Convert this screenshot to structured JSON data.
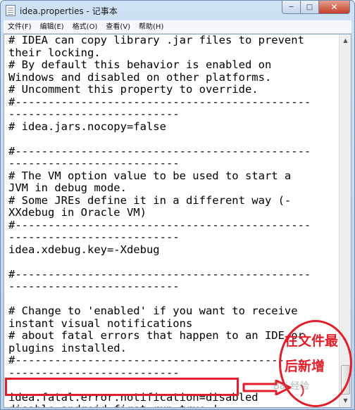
{
  "window": {
    "title": "idea.properties - 记事本",
    "minimize_glyph": "─",
    "maximize_glyph": "□",
    "close_glyph": "✕"
  },
  "menu": {
    "items": [
      "文件(F)",
      "编辑(E)",
      "格式(O)",
      "查看(V)",
      "帮助(H)"
    ]
  },
  "editor": {
    "lines": [
      "# IDEA can copy library .jar files to prevent",
      "their locking.",
      "# By default this behavior is enabled on",
      "Windows and disabled on other platforms.",
      "# Uncomment this property to override.",
      "#---------------------------------------------",
      "--------------------------",
      "# idea.jars.nocopy=false",
      "",
      "#---------------------------------------------",
      "--------------------------",
      "# The VM option value to be used to start a",
      "JVM in debug mode.",
      "# Some JREs define it in a different way (-",
      "XXdebug in Oracle VM)",
      "#---------------------------------------------",
      "--------------------------",
      "idea.xdebug.key=-Xdebug",
      "",
      "#---------------------------------------------",
      "--------------------------",
      "",
      "# Change to 'enabled' if you want to receive",
      "instant visual notifications",
      "# about fatal errors that happen to an IDE or",
      "plugins installed.",
      "#---------------------------------------------",
      "--------------------------",
      "",
      "idea.fatal.error.notification=disabled",
      "disable.android.first.run=true |"
    ],
    "scroll_up_glyph": "▲",
    "scroll_down_glyph": "▼"
  },
  "annotation": {
    "line1": "在文件最",
    "line2": "后新增",
    "line3": "）",
    "watermark": "Bai 经验",
    "color": "#e21e2b"
  }
}
